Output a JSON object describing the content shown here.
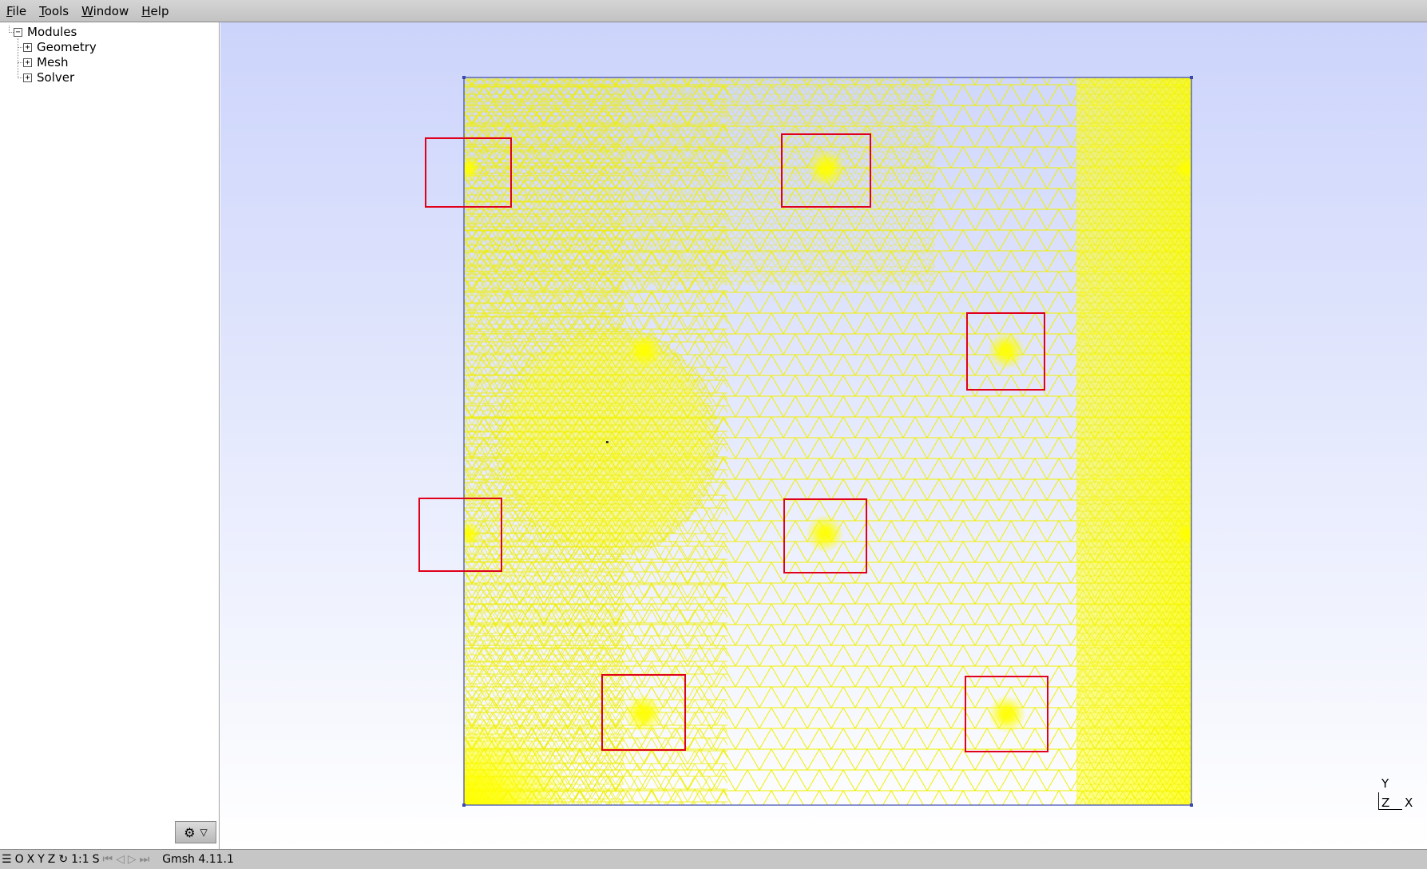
{
  "menubar": {
    "items": [
      {
        "acc": "F",
        "rest": "ile"
      },
      {
        "acc": "T",
        "rest": "ools"
      },
      {
        "acc": "W",
        "rest": "indow"
      },
      {
        "acc": "H",
        "rest": "elp"
      }
    ]
  },
  "tree": {
    "root": {
      "label": "Modules",
      "toggle": "−"
    },
    "children": [
      {
        "label": "Geometry",
        "toggle": "+"
      },
      {
        "label": "Mesh",
        "toggle": "+"
      },
      {
        "label": "Solver",
        "toggle": "+"
      }
    ]
  },
  "settings_button": {
    "icon": "gear-icon",
    "glyph": "⚙",
    "arrow": "▽"
  },
  "axes": {
    "y": "Y",
    "z": "Z",
    "x": "X"
  },
  "statusbar": {
    "menu_glyph": "☰",
    "buttons": [
      "O",
      "X",
      "Y",
      "Z"
    ],
    "rotate_glyph": "↻",
    "scale": "1:1",
    "s": "S",
    "nav": [
      "⏮",
      "◁",
      "▷",
      "⏭"
    ],
    "status": "Gmsh 4.11.1"
  },
  "colors": {
    "mesh": "#ffff00",
    "mesh_line": "#e8e800",
    "highlight_box": "#e8001c",
    "border": "#2f3fa8",
    "bg_top": "#ccd4fb",
    "bg_bottom": "#ffffff"
  }
}
